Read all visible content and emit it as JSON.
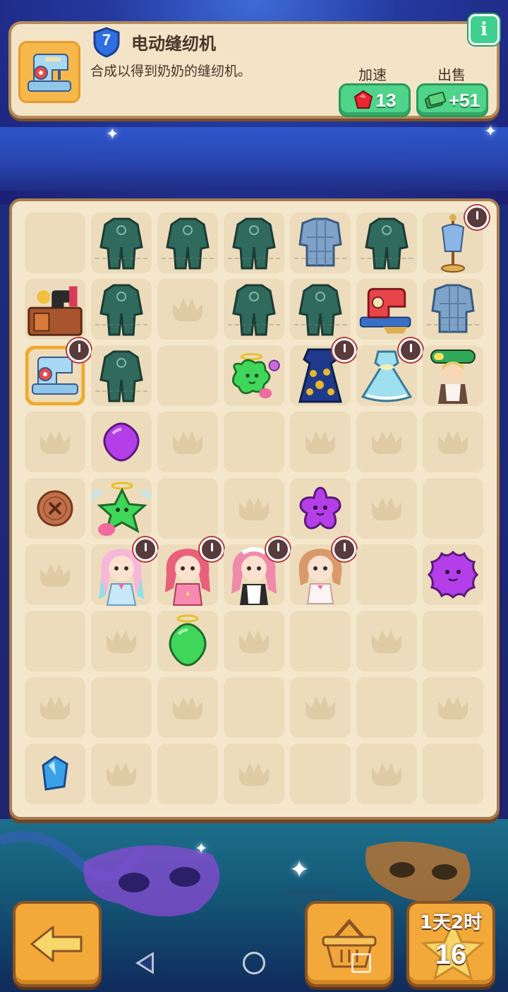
{
  "info_panel": {
    "level": "7",
    "title": "电动缝纫机",
    "description": "合成以得到奶奶的缝纫机。",
    "speed_label": "加速",
    "speed_value": "13",
    "sell_label": "出售",
    "sell_value": "+51",
    "info_icon": "i"
  },
  "colors": {
    "board_bg": "#f4e7cc",
    "cell_bg": "#ecdcbc",
    "accent_green": "#4fd48a",
    "accent_orange": "#f2a93a",
    "timer_red": "#b13a3a"
  },
  "board": {
    "rows": [
      [
        "blank",
        "outfit-dark",
        "outfit-dark",
        "outfit-dark",
        "pajama-blue",
        "outfit-dark",
        "dress-form-timer"
      ],
      [
        "grandma-sewing-machine",
        "outfit-dark",
        "empty",
        "outfit-dark",
        "outfit-dark",
        "red-sewing-machine",
        "pajama-blue"
      ],
      [
        "electric-sewing-machine-timer",
        "outfit-dark",
        "blank",
        "green-angel-blob",
        "gold-gown-timer",
        "fairy-dress-timer",
        "grandma-character-progress"
      ],
      [
        "empty",
        "purple-gem",
        "empty",
        "blank",
        "empty",
        "empty",
        "empty"
      ],
      [
        "button",
        "green-angel-star",
        "blank",
        "empty",
        "purple-star",
        "empty",
        "blank"
      ],
      [
        "empty",
        "girl-pastel-timer",
        "girl-pink-timer",
        "girl-maid-timer",
        "girl-blonde-timer",
        "blank",
        "purple-splat"
      ],
      [
        "blank",
        "empty",
        "green-angel-gem",
        "empty",
        "blank",
        "empty",
        "blank"
      ],
      [
        "empty",
        "blank",
        "empty",
        "blank",
        "empty",
        "blank",
        "empty"
      ],
      [
        "blue-crystal",
        "empty",
        "blank",
        "empty",
        "blank",
        "empty",
        "blank"
      ]
    ]
  },
  "bottom": {
    "back_icon": "arrow-left-icon",
    "shop_icon": "basket-icon",
    "energy_time": "1天2时",
    "energy_count": "16"
  }
}
